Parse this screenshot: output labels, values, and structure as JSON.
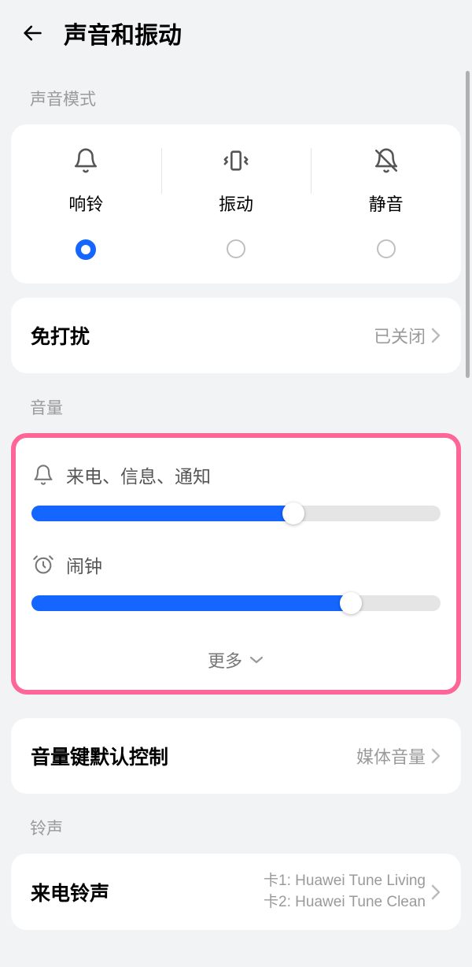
{
  "header": {
    "title": "声音和振动"
  },
  "soundMode": {
    "sectionLabel": "声音模式",
    "options": [
      {
        "label": "响铃",
        "selected": true
      },
      {
        "label": "振动",
        "selected": false
      },
      {
        "label": "静音",
        "selected": false
      }
    ]
  },
  "dnd": {
    "label": "免打扰",
    "value": "已关闭"
  },
  "volume": {
    "sectionLabel": "音量",
    "sliders": [
      {
        "label": "来电、信息、通知",
        "percent": 66
      },
      {
        "label": "闹钟",
        "percent": 80
      }
    ],
    "moreLabel": "更多"
  },
  "volumeKeyControl": {
    "label": "音量键默认控制",
    "value": "媒体音量"
  },
  "ringtone": {
    "sectionLabel": "铃声",
    "callRingtone": {
      "label": "来电铃声",
      "line1": "卡1: Huawei Tune Living",
      "line2": "卡2: Huawei Tune Clean"
    }
  }
}
